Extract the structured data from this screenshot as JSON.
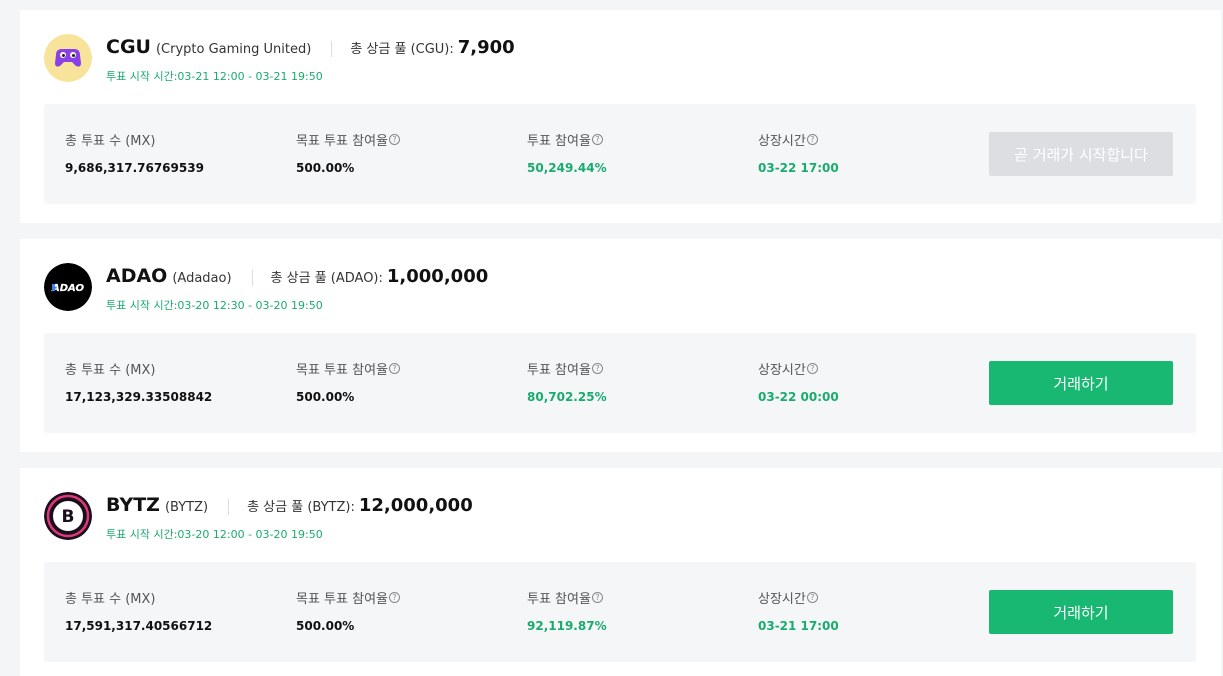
{
  "labels": {
    "total_votes": "총 투표 수 (MX)",
    "target_rate": "목표 투표 참여율",
    "vote_rate": "투표 참여율",
    "listing_time": "상장시간",
    "help_glyph": "?"
  },
  "projects": [
    {
      "symbol": "CGU",
      "full_name": "(Crypto Gaming United)",
      "pool_label": "총 상금 풀 (CGU):",
      "pool_value": "7,900",
      "vote_time": "투표 시작 시간:03-21 12:00 - 03-21 19:50",
      "total_votes": "9,686,317.76769539",
      "target_rate": "500.00%",
      "vote_rate": "50,249.44%",
      "listing_time": "03-22 17:00",
      "button_label": "곧 거래가 시작합니다",
      "button_enabled": false,
      "logo": "gamepad-icon"
    },
    {
      "symbol": "ADAO",
      "full_name": "(Adadao)",
      "pool_label": "총 상금 풀 (ADAO):",
      "pool_value": "1,000,000",
      "vote_time": "투표 시작 시간:03-20 12:30 - 03-20 19:50",
      "total_votes": "17,123,329.33508842",
      "target_rate": "500.00%",
      "vote_rate": "80,702.25%",
      "listing_time": "03-22 00:00",
      "button_label": "거래하기",
      "button_enabled": true,
      "logo": "adao-logo"
    },
    {
      "symbol": "BYTZ",
      "full_name": "(BYTZ)",
      "pool_label": "총 상금 풀 (BYTZ):",
      "pool_value": "12,000,000",
      "vote_time": "투표 시작 시간:03-20 12:00 - 03-20 19:50",
      "total_votes": "17,591,317.40566712",
      "target_rate": "500.00%",
      "vote_rate": "92,119.87%",
      "listing_time": "03-21 17:00",
      "button_label": "거래하기",
      "button_enabled": true,
      "logo": "bytz-logo"
    }
  ],
  "colors": {
    "accent_green": "#18b873",
    "text_green": "#1aab6e",
    "disabled_button": "#dcdee1"
  }
}
